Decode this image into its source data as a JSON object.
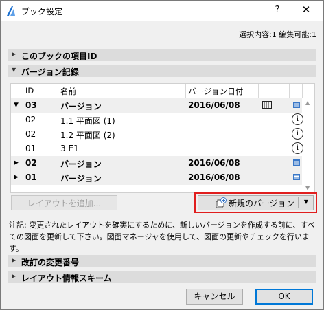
{
  "window": {
    "title": "ブック設定",
    "help": "?",
    "close": "✕",
    "selection_info": "選択内容:1 編集可能:1"
  },
  "sections": {
    "item_id": "このブックの項目ID",
    "version_history": "バージョン記録",
    "revision_number": "改訂の変更番号",
    "layout_info_scheme": "レイアウト情報スキーム"
  },
  "table": {
    "columns": [
      "ID",
      "名前",
      "バージョン日付"
    ],
    "rows": [
      {
        "type": "group",
        "expanded": true,
        "id": "03",
        "name": "バージョン",
        "date": "2016/06/08",
        "icon": "document-icon"
      },
      {
        "type": "item",
        "id": "02",
        "name": "1.1 平面図 (1)",
        "icon": "info-icon"
      },
      {
        "type": "item",
        "id": "02",
        "name": "1.2 平面図 (2)",
        "icon": "info-icon"
      },
      {
        "type": "item",
        "id": "01",
        "name": "3 E1",
        "icon": "info-icon"
      },
      {
        "type": "group",
        "expanded": false,
        "id": "02",
        "name": "バージョン",
        "date": "2016/06/08",
        "icon": "document-icon"
      },
      {
        "type": "group",
        "expanded": false,
        "id": "01",
        "name": "バージョン",
        "date": "2016/06/08",
        "icon": "document-icon"
      }
    ],
    "info_glyph": "i"
  },
  "buttons": {
    "add_layout": "レイアウトを追加...",
    "new_version": "新規のバージョン",
    "cancel": "キャンセル",
    "ok": "OK"
  },
  "note": "注記: 変更されたレイアウトを確実にするために、新しいバージョンを作成する前に、すべての図面を更新して下さい。図面マネージャを使用して、図面の更新やチェックを行います。",
  "colors": {
    "highlight": "#e01e1e",
    "accent": "#0078d7",
    "doc_icon": "#3a78c8"
  }
}
